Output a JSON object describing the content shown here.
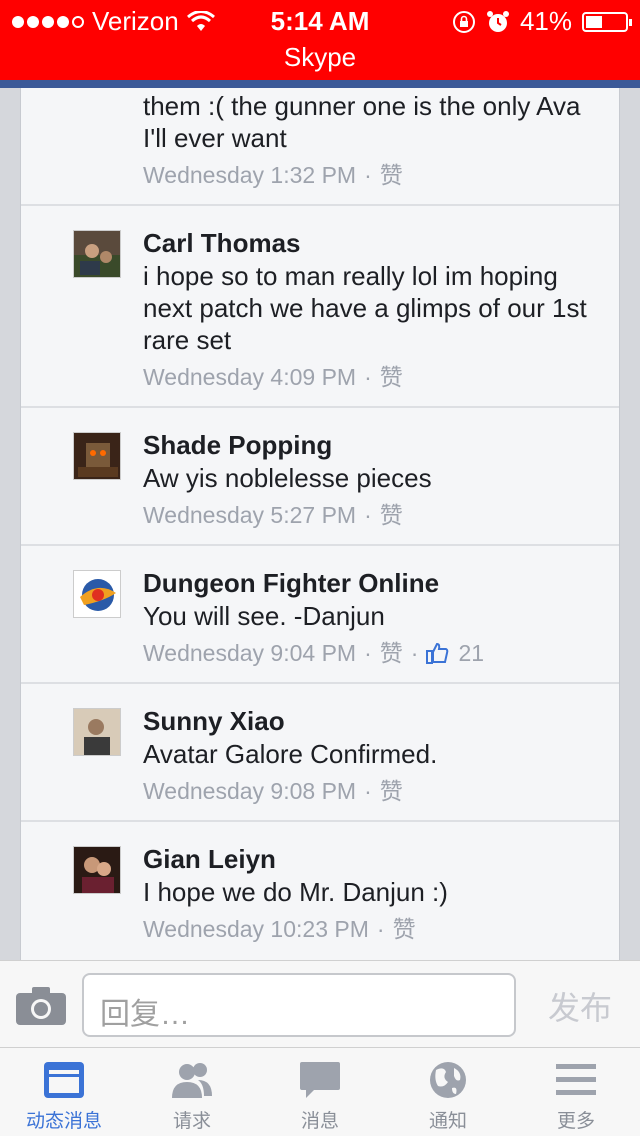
{
  "status_bar": {
    "carrier": "Verizon",
    "time": "5:14 AM",
    "battery": "41%",
    "battery_level": 0.41,
    "app": "Skype"
  },
  "comments": [
    {
      "author": "",
      "text": "them :( the gunner one is the only Ava I'll ever want",
      "time": "Wednesday 1:32 PM",
      "like_label": "赞",
      "likes": ""
    },
    {
      "author": "Carl Thomas",
      "text": "i hope so to man really lol im hoping next patch we have a glimps of our 1st rare set",
      "time": "Wednesday 4:09 PM",
      "like_label": "赞",
      "likes": ""
    },
    {
      "author": "Shade Popping",
      "text": "Aw yis noblelesse pieces",
      "time": "Wednesday 5:27 PM",
      "like_label": "赞",
      "likes": ""
    },
    {
      "author": "Dungeon Fighter Online",
      "text": "You will see. -Danjun",
      "time": "Wednesday 9:04 PM",
      "like_label": "赞",
      "likes": "21"
    },
    {
      "author": "Sunny Xiao",
      "text": "Avatar Galore Confirmed.",
      "time": "Wednesday 9:08 PM",
      "like_label": "赞",
      "likes": ""
    },
    {
      "author": "Gian Leiyn",
      "text": "I hope we do Mr. Danjun :)",
      "time": "Wednesday 10:23 PM",
      "like_label": "赞",
      "likes": ""
    }
  ],
  "composer": {
    "placeholder": "回复…",
    "post_label": "发布"
  },
  "tabs": [
    {
      "label": "动态消息",
      "icon": "news-feed-icon",
      "active": true
    },
    {
      "label": "请求",
      "icon": "friend-requests-icon",
      "active": false
    },
    {
      "label": "消息",
      "icon": "messages-icon",
      "active": false
    },
    {
      "label": "通知",
      "icon": "globe-icon",
      "active": false
    },
    {
      "label": "更多",
      "icon": "menu-icon",
      "active": false
    }
  ],
  "colors": {
    "status_bar": "#ff0000",
    "brand_blue": "#3b5998",
    "active_tab": "#3b73d6"
  }
}
